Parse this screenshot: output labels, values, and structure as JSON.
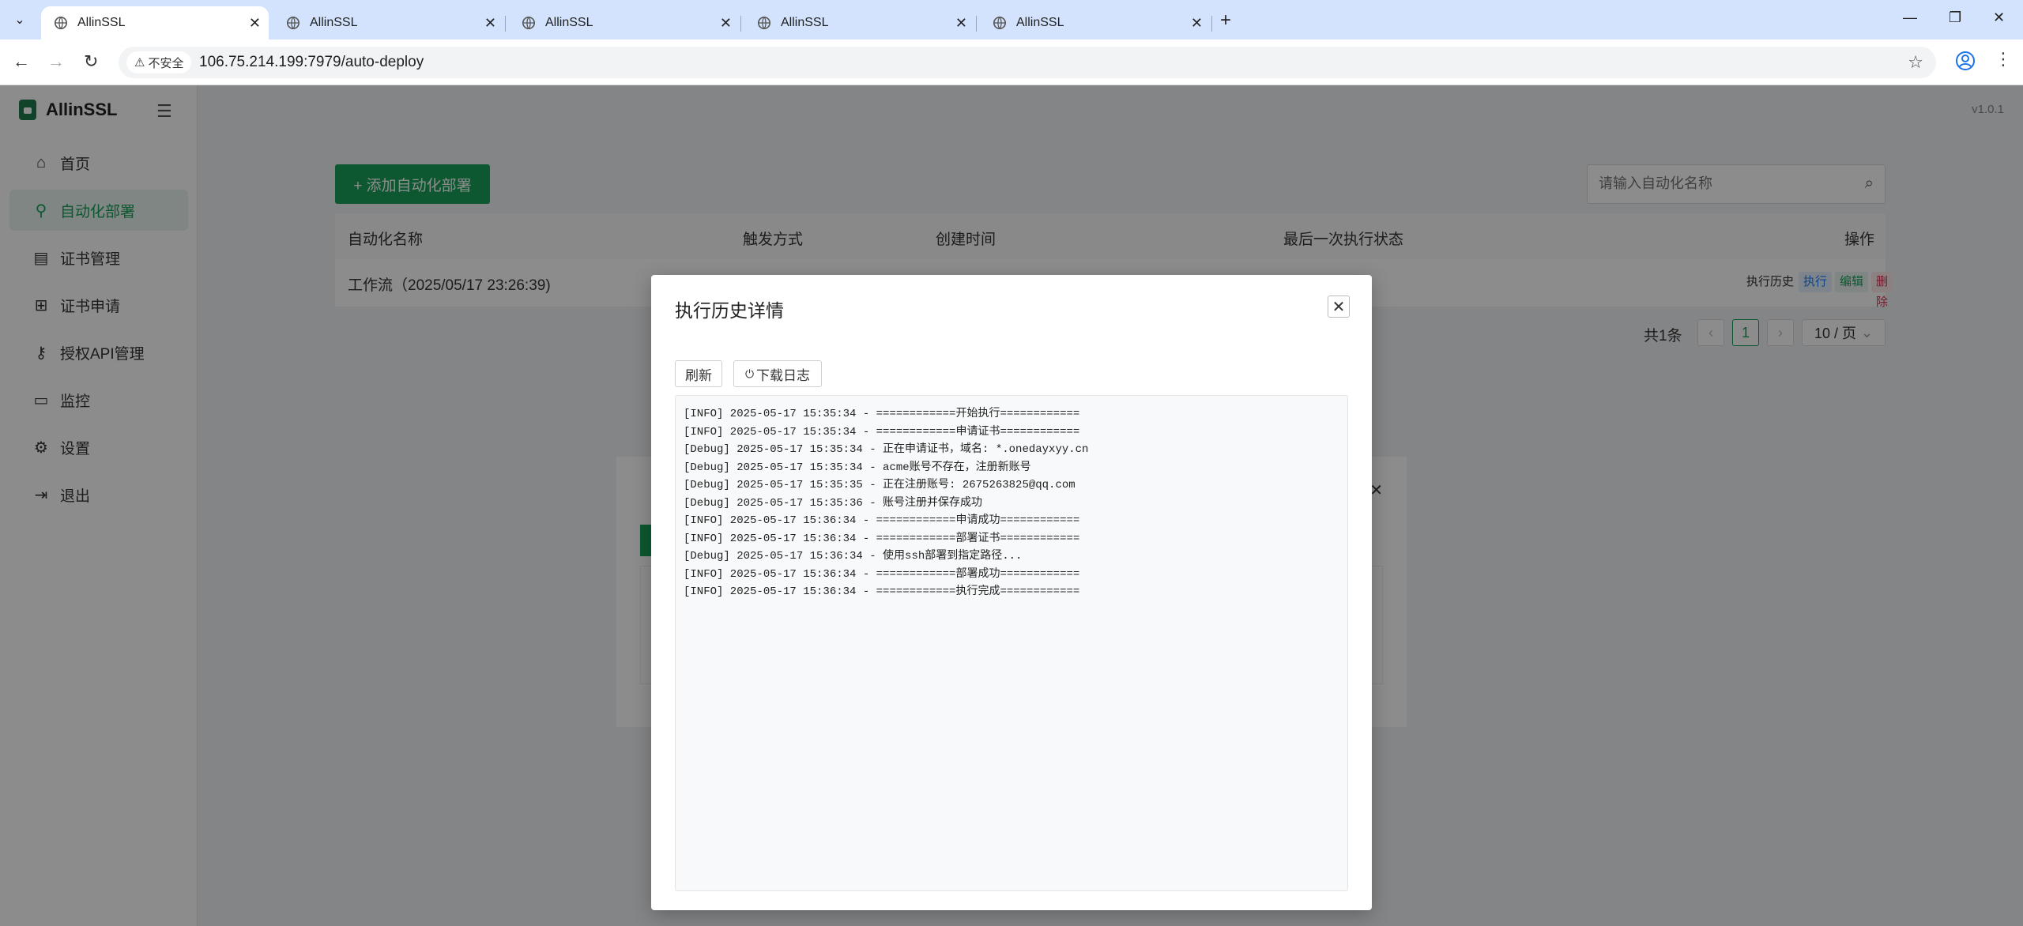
{
  "browser": {
    "tabs": [
      {
        "title": "AllinSSL",
        "active": true
      },
      {
        "title": "AllinSSL",
        "active": false
      },
      {
        "title": "AllinSSL",
        "active": false
      },
      {
        "title": "AllinSSL",
        "active": false
      },
      {
        "title": "AllinSSL",
        "active": false
      }
    ],
    "security_label": "不安全",
    "url": "106.75.214.199:7979/auto-deploy"
  },
  "app": {
    "brand": "AllinSSL",
    "version": "v1.0.1",
    "menu": [
      {
        "label": "首页",
        "icon": "home-icon",
        "active": false
      },
      {
        "label": "自动化部署",
        "icon": "workflow-icon",
        "active": true
      },
      {
        "label": "证书管理",
        "icon": "certificate-icon",
        "active": false
      },
      {
        "label": "证书申请",
        "icon": "add-square-icon",
        "active": false
      },
      {
        "label": "授权API管理",
        "icon": "key-icon",
        "active": false
      },
      {
        "label": "监控",
        "icon": "monitor-icon",
        "active": false
      },
      {
        "label": "设置",
        "icon": "gear-icon",
        "active": false
      },
      {
        "label": "退出",
        "icon": "logout-icon",
        "active": false
      }
    ]
  },
  "page": {
    "add_button": "+ 添加自动化部署",
    "search_placeholder": "请输入自动化名称",
    "table": {
      "headers": [
        "自动化名称",
        "触发方式",
        "创建时间",
        "最后一次执行状态",
        "操作"
      ],
      "rows": [
        {
          "name": "工作流（2025/05/17 23:26:39)"
        }
      ],
      "actions": [
        "执行历史",
        "执行",
        "编辑",
        "删除"
      ]
    },
    "pagination": {
      "total": "共1条",
      "current": "1",
      "page_size": "10 / 页"
    }
  },
  "modal": {
    "title": "执行历史详情",
    "refresh_button": "刷新",
    "download_button": "下载日志",
    "log_lines": [
      "[INFO] 2025-05-17 15:35:34 - ============开始执行============",
      "[INFO] 2025-05-17 15:35:34 - ============申请证书============",
      "[Debug] 2025-05-17 15:35:34 - 正在申请证书，域名: *.onedayxyy.cn",
      "[Debug] 2025-05-17 15:35:34 - acme账号不存在，注册新账号",
      "[Debug] 2025-05-17 15:35:35 - 正在注册账号: 2675263825@qq.com",
      "[Debug] 2025-05-17 15:35:36 - 账号注册并保存成功",
      "[INFO] 2025-05-17 15:36:34 - ============申请成功============",
      "[INFO] 2025-05-17 15:36:34 - ============部署证书============",
      "[Debug] 2025-05-17 15:36:34 - 使用ssh部署到指定路径...",
      "[INFO] 2025-05-17 15:36:34 - ============部署成功============",
      "[INFO] 2025-05-17 15:36:34 - ============执行完成============"
    ]
  },
  "colors": {
    "accent": "#18a058",
    "tab_bar": "#d3e3fd"
  }
}
